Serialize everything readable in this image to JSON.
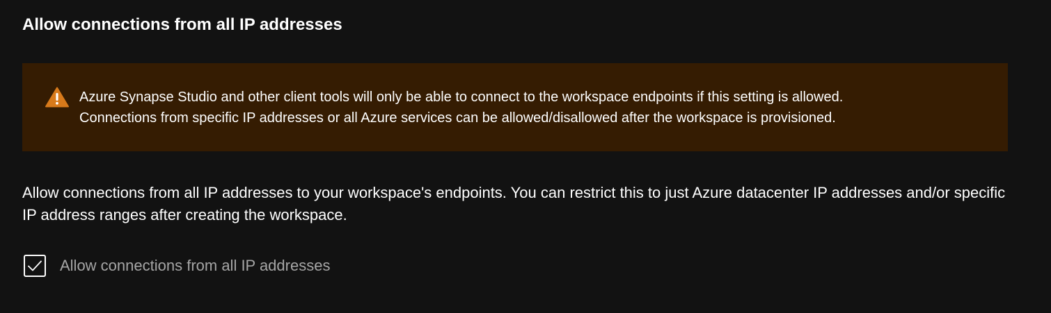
{
  "section": {
    "title": "Allow connections from all IP addresses"
  },
  "warning": {
    "icon": "warning-triangle-icon",
    "color": "#d87a1b",
    "background": "#351c02",
    "line1": "Azure Synapse Studio and other client tools will only be able to connect to the workspace endpoints if this setting is allowed.",
    "line2": "Connections from specific IP addresses or all Azure services can be allowed/disallowed after the workspace is provisioned."
  },
  "description": {
    "text": "Allow connections from all IP addresses to your workspace's endpoints. You can restrict this to just Azure datacenter IP addresses and/or specific IP address ranges after creating the workspace."
  },
  "checkbox": {
    "label": "Allow connections from all IP addresses",
    "checked": true,
    "icon": "checkmark-icon"
  }
}
